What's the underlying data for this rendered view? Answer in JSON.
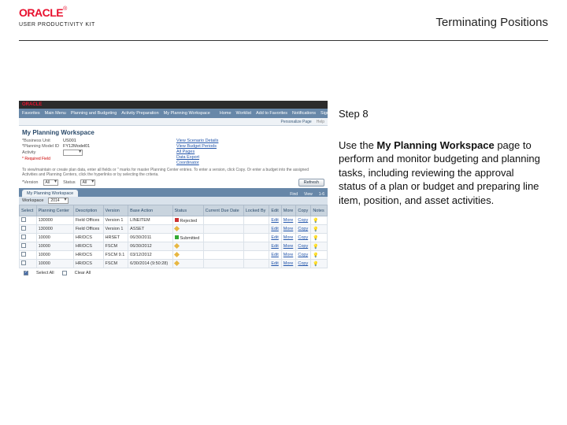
{
  "header": {
    "brand": "ORACLE",
    "reg": "®",
    "product": "USER PRODUCTIVITY KIT",
    "title": "Terminating Positions"
  },
  "step": {
    "label": "Step 8",
    "body_prefix": "Use the ",
    "body_bold": "My Planning Workspace",
    "body_suffix": " page to perform and monitor budgeting and planning tasks, including reviewing the approval status of a plan or budget and preparing line item, position, and asset activities."
  },
  "app": {
    "topbar_brand": "ORACLE",
    "nav": {
      "left": [
        "Favorites",
        "Main Menu",
        "Planning and Budgeting",
        "Activity Preparation",
        "My Planning Workspace"
      ],
      "right": [
        "Home",
        "Worklist",
        "Add to Favorites",
        "Notifications",
        "Sign out"
      ]
    },
    "subnav": {
      "expand": "Personalize Page",
      "help": "Help"
    },
    "page_title": "My Planning Workspace",
    "form": {
      "business_unit_lbl": "*Business Unit",
      "business_unit": "US001",
      "plan_model_lbl": "*Planning Model ID",
      "plan_model": "FY12Model01",
      "activity_lbl": "Activity",
      "ast_note": "* Required Field",
      "right_links": [
        "View Scenario Details",
        "View Budget Periods",
        "All Pages",
        "Data Export",
        "Coordinator"
      ]
    },
    "hint": "To view/maintain or create plan data, enter all fields or \" marks for master Planning Center entries. To enter a version, click Copy. Or enter a budget into the assigned Activities and Planning Centers, click the hyperlinks or by selecting the criteria.",
    "mid": {
      "version_lbl": "*Version",
      "version_val": "All",
      "status_lbl": "Status",
      "status_val": "All",
      "refresh": "Refresh"
    },
    "tabs": {
      "main": "My Planning Workspace",
      "tools": [
        "Find",
        "View",
        "1-6"
      ]
    },
    "subtabs": {
      "workspace_lbl": "Workspace",
      "as_of": "2014"
    },
    "columns": [
      "Select",
      "Planning Center",
      "Description",
      "Version",
      "Base Action",
      "Status",
      "Current Due Date",
      "Locked By",
      "Edit",
      "More",
      "Copy",
      "Notes"
    ],
    "rows": [
      {
        "pc": "130000",
        "desc": "Field Offices",
        "ver": "Version 1",
        "ba": "LINEITEM",
        "status": "Rejected",
        "sd": "red",
        "due": "",
        "lock": "",
        "edit": "Edit",
        "more": "More",
        "copy": "Copy"
      },
      {
        "pc": "130000",
        "desc": "Field Offices",
        "ver": "Version 1",
        "ba": "ASSET",
        "status": "",
        "sd": "amber",
        "due": "",
        "lock": "",
        "edit": "Edit",
        "more": "More",
        "copy": "Copy"
      },
      {
        "pc": "10000",
        "desc": "HR/DCS",
        "ver": "HRSET",
        "ba": "06/30/2011",
        "status": "Submitted",
        "sd": "green",
        "due": "",
        "lock": "",
        "edit": "Edit",
        "more": "More",
        "copy": "Copy"
      },
      {
        "pc": "10000",
        "desc": "HR/DCS",
        "ver": "FSCM",
        "ba": "06/30/2012",
        "status": "",
        "sd": "amber",
        "due": "",
        "lock": "",
        "edit": "Edit",
        "more": "More",
        "copy": "Copy"
      },
      {
        "pc": "10000",
        "desc": "HR/DCS",
        "ver": "FSCM 9.1",
        "ba": "03/12/2012",
        "status": "",
        "sd": "amber",
        "due": "",
        "lock": "",
        "edit": "Edit",
        "more": "More",
        "copy": "Copy"
      },
      {
        "pc": "10000",
        "desc": "HR/DCS",
        "ver": "FSCM",
        "ba": "6/30/2014 (9:50:28)",
        "status": "",
        "sd": "amber",
        "due": "",
        "lock": "",
        "edit": "Edit",
        "more": "More",
        "copy": "Copy"
      }
    ],
    "legend": {
      "select_all": "Select All",
      "clear_all": "Clear All"
    }
  }
}
